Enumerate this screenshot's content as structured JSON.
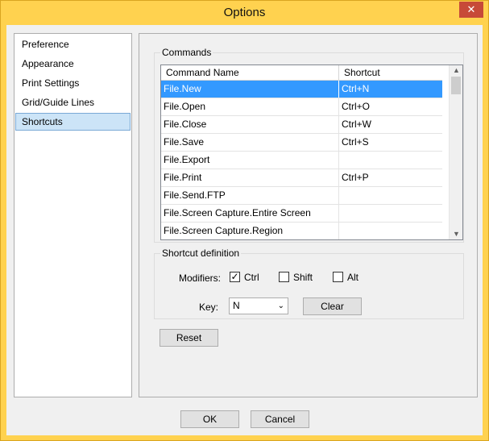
{
  "window": {
    "title": "Options",
    "close_glyph": "✕"
  },
  "nav": {
    "items": [
      {
        "label": "Preference"
      },
      {
        "label": "Appearance"
      },
      {
        "label": "Print Settings"
      },
      {
        "label": "Grid/Guide Lines"
      },
      {
        "label": "Shortcuts"
      }
    ],
    "selected": "Shortcuts"
  },
  "commands": {
    "group_title": "Commands",
    "columns": [
      "Command Name",
      "Shortcut"
    ],
    "rows": [
      {
        "name": "File.New",
        "shortcut": "Ctrl+N"
      },
      {
        "name": "File.Open",
        "shortcut": "Ctrl+O"
      },
      {
        "name": "File.Close",
        "shortcut": "Ctrl+W"
      },
      {
        "name": "File.Save",
        "shortcut": "Ctrl+S"
      },
      {
        "name": "File.Export",
        "shortcut": ""
      },
      {
        "name": "File.Print",
        "shortcut": "Ctrl+P"
      },
      {
        "name": "File.Send.FTP",
        "shortcut": ""
      },
      {
        "name": "File.Screen Capture.Entire Screen",
        "shortcut": ""
      },
      {
        "name": "File.Screen Capture.Region",
        "shortcut": ""
      }
    ]
  },
  "shortcut_definition": {
    "group_title": "Shortcut definition",
    "modifiers_label": "Modifiers:",
    "ctrl": {
      "label": "Ctrl",
      "checked": true,
      "mark": "✓"
    },
    "shift": {
      "label": "Shift",
      "checked": false,
      "mark": ""
    },
    "alt": {
      "label": "Alt",
      "checked": false,
      "mark": ""
    },
    "key_label": "Key:",
    "key_value": "N",
    "clear_label": "Clear"
  },
  "reset_label": "Reset",
  "footer": {
    "ok_label": "OK",
    "cancel_label": "Cancel"
  },
  "colors": {
    "accent": "#ffd24f",
    "selection": "#3399ff"
  },
  "icons": {
    "close": "close-icon",
    "dropdown": "chevron-down-icon",
    "scroll_up": "chevron-up-icon",
    "scroll_down": "chevron-down-icon"
  }
}
